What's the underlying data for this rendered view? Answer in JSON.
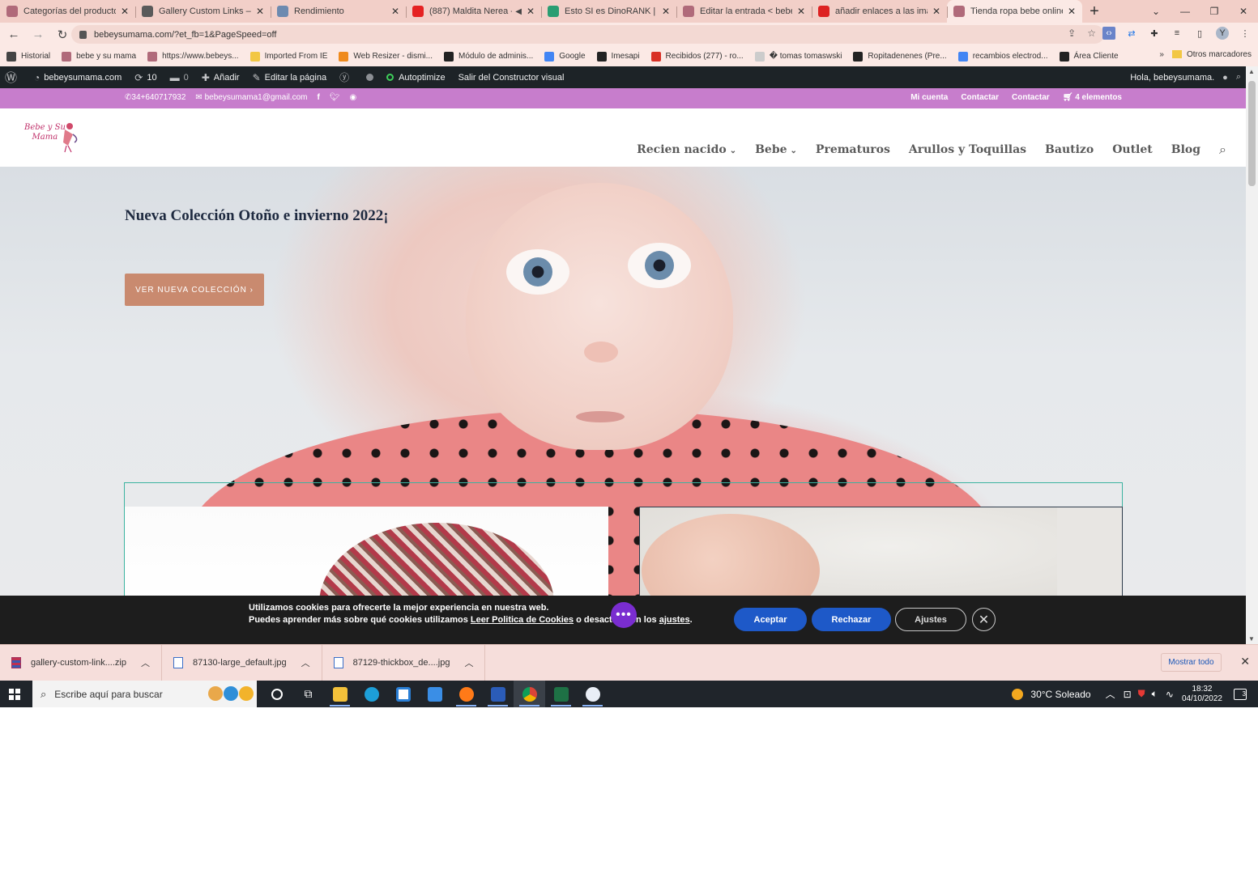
{
  "browser": {
    "tabs": [
      {
        "title": "Categorías del producto <",
        "color": "#b06a7a",
        "active": false
      },
      {
        "title": "Gallery Custom Links – Plu",
        "color": "#5a5a5a",
        "active": false
      },
      {
        "title": "Rendimiento",
        "color": "#6d8ab0",
        "active": false
      },
      {
        "title": "(887) Maldita Nerea -",
        "color": "#e52222",
        "active": false,
        "audio": true
      },
      {
        "title": "Esto SI es DinoRANK | Her",
        "color": "#2a9d72",
        "active": false
      },
      {
        "title": "Editar la entrada < bebeys",
        "color": "#b06a7a",
        "active": false
      },
      {
        "title": "añadir enlaces a las image",
        "color": "#d22",
        "active": false
      },
      {
        "title": "Tienda ropa bebe online|",
        "color": "#b06a7a",
        "active": true
      }
    ],
    "url": "bebeysumama.com/?et_fb=1&PageSpeed=off",
    "bookmarks": [
      {
        "label": "Historial",
        "color": "#444"
      },
      {
        "label": "bebe y su mama",
        "color": "#b06a7a"
      },
      {
        "label": "https://www.bebeys...",
        "color": "#b06a7a"
      },
      {
        "label": "Imported From IE",
        "color": "#f2c744"
      },
      {
        "label": "Web Resizer - dismi...",
        "color": "#ef8a1c"
      },
      {
        "label": "Módulo de adminis...",
        "color": "#222"
      },
      {
        "label": "Google",
        "color": "#4285f4"
      },
      {
        "label": "Imesapi",
        "color": "#222"
      },
      {
        "label": "Recibidos (277) - ro...",
        "color": "#d93025"
      },
      {
        "label": "� tomas tomaswski",
        "color": "#ccc"
      },
      {
        "label": "Ropitadenenes (Pre...",
        "color": "#222"
      },
      {
        "label": "recambios electrod...",
        "color": "#4285f4"
      },
      {
        "label": "Área Cliente",
        "color": "#222"
      }
    ],
    "bookmarks_more": "»",
    "other_bookmarks": "Otros marcadores",
    "profile_initial": "Y"
  },
  "wp_admin_bar": {
    "site": "bebeysumama.com",
    "updates": "10",
    "comments": "0",
    "add": "Añadir",
    "edit_page": "Editar la página",
    "autoptimize": "Autoptimize",
    "exit_builder": "Salir del Constructor visual",
    "greeting": "Hola, bebeysumama."
  },
  "site": {
    "phone": "34+640717932",
    "email": "bebeysumama1@gmail.com",
    "top_links": [
      "Mi cuenta",
      "Contactar",
      "Contactar"
    ],
    "cart": "4 elementos",
    "logo_text_1": "Bebe y Su",
    "logo_text_2": "Mama",
    "nav": [
      {
        "label": "Recien nacido",
        "dropdown": true
      },
      {
        "label": "Bebe",
        "dropdown": true
      },
      {
        "label": "Prematuros",
        "dropdown": false
      },
      {
        "label": "Arullos y Toquillas",
        "dropdown": false
      },
      {
        "label": "Bautizo",
        "dropdown": false
      },
      {
        "label": "Outlet",
        "dropdown": false
      },
      {
        "label": "Blog",
        "dropdown": false
      }
    ],
    "hero_title": "Nueva Colección Otoño e invierno 2022¡",
    "hero_button": "VER NUEVA COLECCIÓN  ›"
  },
  "cookie_banner": {
    "line1": "Utilizamos cookies para ofrecerte la mejor experiencia en nuestra web.",
    "line2_a": "Puedes aprender más sobre qué cookies utilizamos ",
    "line2_link": "Leer Politica de Cookies",
    "line2_b": " o desactiv",
    "line2_c": "en los ",
    "line2_link2": "ajustes",
    "line2_end": ".",
    "accept": "Aceptar",
    "reject": "Rechazar",
    "settings": "Ajustes"
  },
  "downloads": {
    "items": [
      "gallery-custom-link....zip",
      "87130-large_default.jpg",
      "87129-thickbox_de....jpg"
    ],
    "show_all": "Mostrar todo"
  },
  "taskbar": {
    "search_placeholder": "Escribe aquí para buscar",
    "weather": "30°C  Soleado",
    "time": "18:32",
    "date": "04/10/2022",
    "notifications": "3"
  }
}
